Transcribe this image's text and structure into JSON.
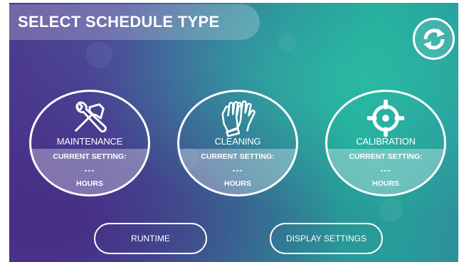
{
  "header": {
    "title": "SELECT SCHEDULE TYPE"
  },
  "refresh": {
    "icon": "refresh-icon"
  },
  "tiles": [
    {
      "label": "MAINTENANCE",
      "setting_label": "CURRENT SETTING:",
      "value": "---",
      "unit": "HOURS",
      "icon": "tools-icon"
    },
    {
      "label": "CLEANING",
      "setting_label": "CURRENT SETTING:",
      "value": "---",
      "unit": "HOURS",
      "icon": "gloves-icon"
    },
    {
      "label": "CALIBRATION",
      "setting_label": "CURRENT SETTING:",
      "value": "---",
      "unit": "HOURS",
      "icon": "crosshair-icon"
    }
  ],
  "buttons": {
    "runtime": "RUNTIME",
    "display_settings": "DISPLAY SETTINGS"
  },
  "colors": {
    "background_left": "#4d3a8f",
    "background_right": "#24a89a",
    "foreground": "#ffffff"
  }
}
